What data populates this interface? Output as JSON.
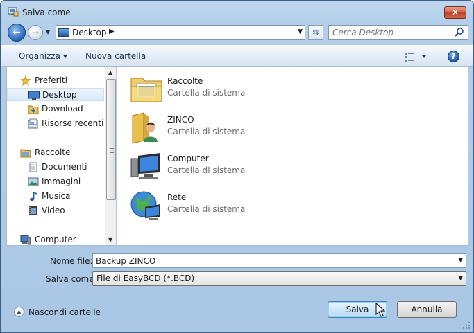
{
  "window": {
    "title": "Salva come",
    "close_glyph": "✕"
  },
  "nav": {
    "back_glyph": "←",
    "forward_glyph": "→",
    "address": {
      "icon": "desktop-icon",
      "crumb": "Desktop"
    },
    "search": {
      "placeholder": "Cerca Desktop"
    }
  },
  "toolbar": {
    "organize_label": "Organizza ▾",
    "new_folder_label": "Nuova cartella",
    "help_glyph": "?"
  },
  "sidebar": {
    "items": [
      {
        "label": "Preferiti",
        "icon": "star-icon",
        "group": true
      },
      {
        "label": "Desktop",
        "icon": "desktop-icon",
        "selected": true
      },
      {
        "label": "Download",
        "icon": "download-folder-icon"
      },
      {
        "label": "Risorse recenti",
        "icon": "recent-places-icon"
      },
      {
        "label": "Raccolte",
        "icon": "libraries-icon",
        "group": true
      },
      {
        "label": "Documenti",
        "icon": "documents-icon"
      },
      {
        "label": "Immagini",
        "icon": "pictures-icon"
      },
      {
        "label": "Musica",
        "icon": "music-icon"
      },
      {
        "label": "Video",
        "icon": "video-icon"
      },
      {
        "label": "Computer",
        "icon": "computer-icon",
        "group": true
      }
    ]
  },
  "content": {
    "tiles": [
      {
        "name": "Raccolte",
        "sub": "Cartella di sistema",
        "icon": "libraries-folder-icon"
      },
      {
        "name": "ZINCO",
        "sub": "Cartella di sistema",
        "icon": "user-folder-icon"
      },
      {
        "name": "Computer",
        "sub": "Cartella di sistema",
        "icon": "computer-icon"
      },
      {
        "name": "Rete",
        "sub": "Cartella di sistema",
        "icon": "network-icon"
      }
    ]
  },
  "form": {
    "filename_label": "Nome file:",
    "filename_value": "Backup ZINCO",
    "filetype_label": "Salva come:",
    "filetype_value": "File di EasyBCD (*.BCD)"
  },
  "footer": {
    "hide_folders_label": "Nascondi cartelle",
    "save_label": "Salva",
    "cancel_label": "Annulla"
  }
}
